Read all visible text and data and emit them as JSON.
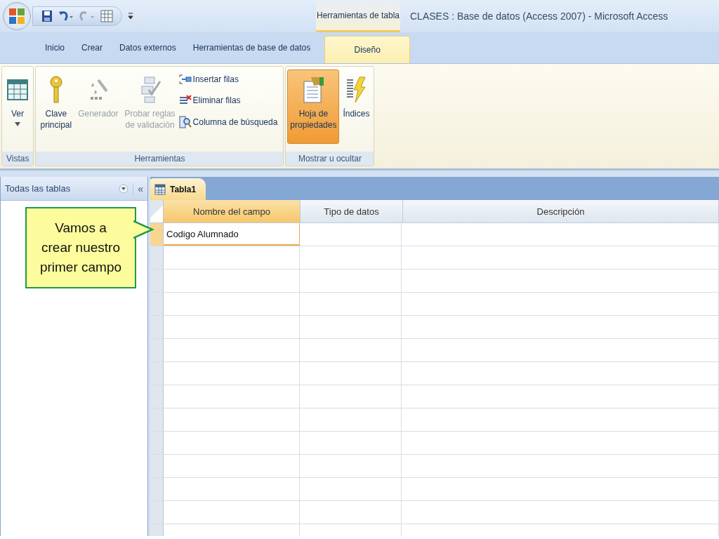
{
  "window": {
    "title": "CLASES : Base de datos (Access 2007) - Microsoft Access",
    "context_group": "Herramientas de tabla"
  },
  "ribbon_tabs": [
    {
      "label": "Inicio",
      "selected": false
    },
    {
      "label": "Crear",
      "selected": false
    },
    {
      "label": "Datos externos",
      "selected": false
    },
    {
      "label": "Herramientas de base de datos",
      "selected": false
    },
    {
      "label": "Diseño",
      "selected": true
    }
  ],
  "ribbon_groups": [
    {
      "label": "Vistas",
      "buttons": [
        {
          "kind": "large",
          "label": "Ver",
          "dropdown": true,
          "disabled": false,
          "selected": false
        }
      ]
    },
    {
      "label": "Herramientas",
      "buttons": [
        {
          "kind": "large",
          "label": "Clave\nprincipal",
          "disabled": false,
          "selected": false
        },
        {
          "kind": "large",
          "label": "Generador",
          "disabled": true,
          "selected": false
        },
        {
          "kind": "large",
          "label": "Probar reglas\nde validación",
          "disabled": true,
          "selected": false
        },
        {
          "kind": "small",
          "label": "Insertar filas",
          "disabled": false,
          "selected": false
        },
        {
          "kind": "small",
          "label": "Eliminar filas",
          "disabled": false,
          "selected": false
        },
        {
          "kind": "small",
          "label": "Columna de búsqueda",
          "disabled": false,
          "selected": false
        }
      ]
    },
    {
      "label": "Mostrar u ocultar",
      "buttons": [
        {
          "kind": "large",
          "label": "Hoja de\npropiedades",
          "disabled": false,
          "selected": true
        },
        {
          "kind": "large",
          "label": "Índices",
          "disabled": false,
          "selected": false
        }
      ]
    }
  ],
  "nav_pane": {
    "title": "Todas las tablas",
    "collapse": "«"
  },
  "document_tabs": [
    {
      "label": "Tabla1",
      "selected": true
    }
  ],
  "table": {
    "columns": [
      "Nombre del campo",
      "Tipo de datos",
      "Descripción"
    ],
    "rows": [
      {
        "field_name": "Codigo Alumnado",
        "selected": true
      }
    ]
  },
  "callout": {
    "text": "Vamos a crear nuestro primer campo"
  }
}
